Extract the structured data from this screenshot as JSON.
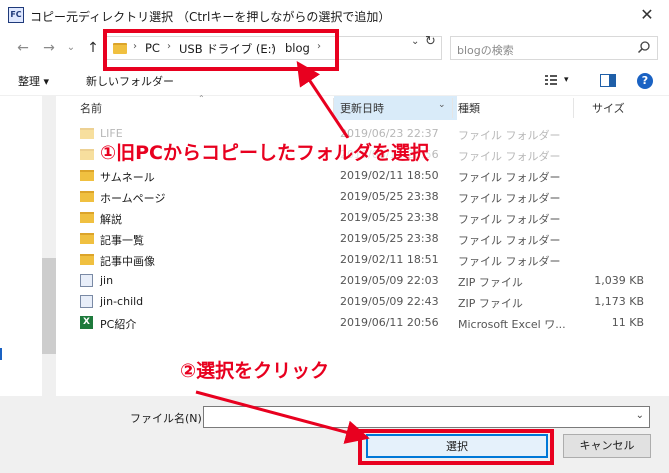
{
  "window": {
    "title": "コピー元ディレクトリ選択 （Ctrlキーを押しながらの選択で追加）",
    "close_glyph": "✕",
    "icon_text": "FC"
  },
  "nav": {
    "back": "←",
    "forward": "→",
    "dropdown": "⌄",
    "up": "↑"
  },
  "address": {
    "crumbs": [
      "PC",
      "USB ドライブ (E:)",
      "blog"
    ],
    "separator": "›",
    "dropdown": "⌄",
    "refresh": "↻"
  },
  "search": {
    "placeholder": "blogの検索"
  },
  "toolbar": {
    "organize": "整理 ▾",
    "new_folder": "新しいフォルダー",
    "view_menu": "▾",
    "help": "?"
  },
  "columns": {
    "name": "名前",
    "date": "更新日時",
    "type": "種類",
    "size": "サイズ",
    "sort_indicator": "⌃",
    "date_drop": "⌄"
  },
  "files": [
    {
      "name": "LIFE",
      "date": "2019/06/23 22:37",
      "type": "ファイル フォルダー",
      "size": "",
      "kind": "folder",
      "faded": true
    },
    {
      "name": "",
      "date": "2019/06/11 20:56",
      "type": "ファイル フォルダー",
      "size": "",
      "kind": "folder",
      "faded": true
    },
    {
      "name": "サムネール",
      "date": "2019/02/11 18:50",
      "type": "ファイル フォルダー",
      "size": "",
      "kind": "folder",
      "faded": false
    },
    {
      "name": "ホームページ",
      "date": "2019/05/25 23:38",
      "type": "ファイル フォルダー",
      "size": "",
      "kind": "folder",
      "faded": false
    },
    {
      "name": "解説",
      "date": "2019/05/25 23:38",
      "type": "ファイル フォルダー",
      "size": "",
      "kind": "folder",
      "faded": false
    },
    {
      "name": "記事一覧",
      "date": "2019/05/25 23:38",
      "type": "ファイル フォルダー",
      "size": "",
      "kind": "folder",
      "faded": false
    },
    {
      "name": "記事中画像",
      "date": "2019/02/11 18:51",
      "type": "ファイル フォルダー",
      "size": "",
      "kind": "folder",
      "faded": false
    },
    {
      "name": "jin",
      "date": "2019/05/09 22:03",
      "type": "ZIP ファイル",
      "size": "1,039 KB",
      "kind": "zip",
      "faded": false
    },
    {
      "name": "jin-child",
      "date": "2019/05/09 22:43",
      "type": "ZIP ファイル",
      "size": "1,173 KB",
      "kind": "zip",
      "faded": false
    },
    {
      "name": "PC紹介",
      "date": "2019/06/11 20:56",
      "type": "Microsoft Excel ワ...",
      "size": "11 KB",
      "kind": "excel",
      "faded": false
    }
  ],
  "bottom": {
    "filename_label": "ファイル名(N):",
    "filename_value": "",
    "filename_drop": "⌄",
    "select_button": "選択",
    "cancel_button": "キャンセル"
  },
  "annotations": {
    "step1": "①旧PCからコピーしたフォルダを選択",
    "step2": "②選択をクリック",
    "color": "#e8001f"
  }
}
